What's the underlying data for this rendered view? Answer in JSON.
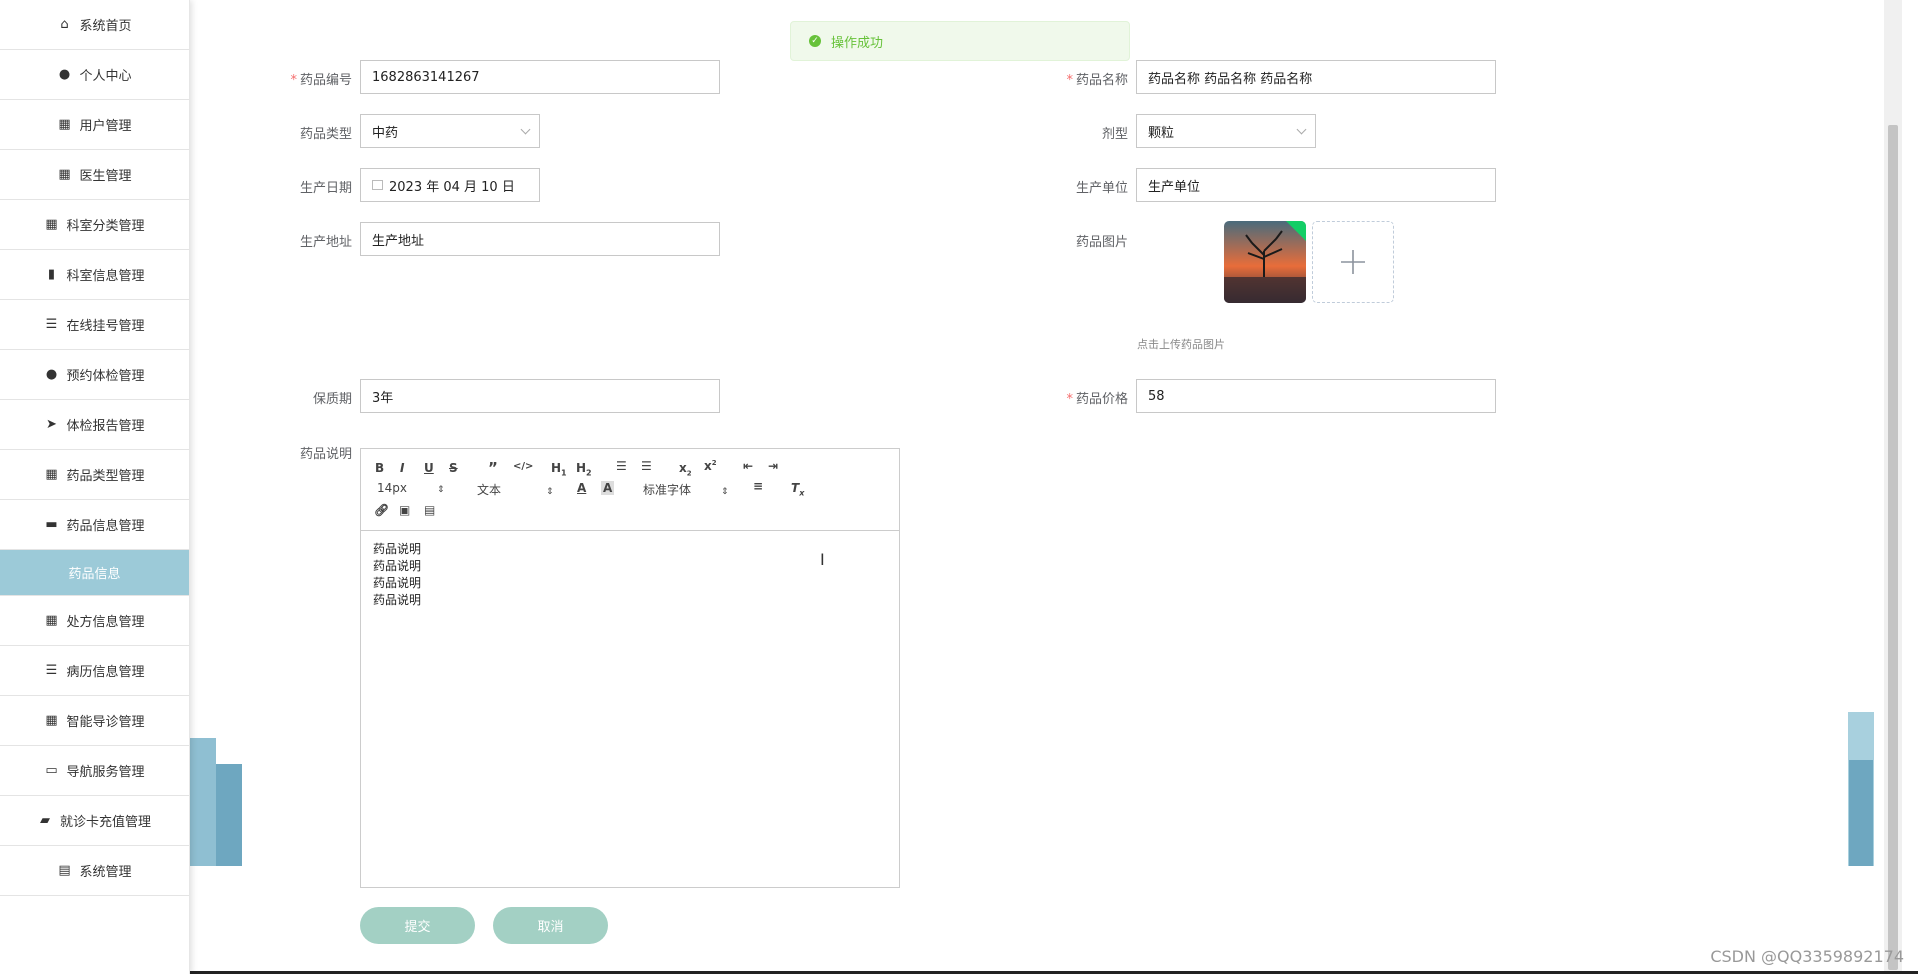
{
  "sidebar": {
    "items": [
      {
        "label": "系统首页",
        "icon": "home-icon"
      },
      {
        "label": "个人中心",
        "icon": "user-icon"
      },
      {
        "label": "用户管理",
        "icon": "grid-icon"
      },
      {
        "label": "医生管理",
        "icon": "grid-icon"
      },
      {
        "label": "科室分类管理",
        "icon": "grid-icon"
      },
      {
        "label": "科室信息管理",
        "icon": "clipboard-icon"
      },
      {
        "label": "在线挂号管理",
        "icon": "list-icon"
      },
      {
        "label": "预约体检管理",
        "icon": "user-icon"
      },
      {
        "label": "体检报告管理",
        "icon": "send-icon"
      },
      {
        "label": "药品类型管理",
        "icon": "grid-icon"
      },
      {
        "label": "药品信息管理",
        "icon": "monitor-icon"
      },
      {
        "label": "药品信息",
        "icon": ""
      },
      {
        "label": "处方信息管理",
        "icon": "grid-icon"
      },
      {
        "label": "病历信息管理",
        "icon": "list-icon"
      },
      {
        "label": "智能导诊管理",
        "icon": "grid-icon"
      },
      {
        "label": "导航服务管理",
        "icon": "ticket-icon"
      },
      {
        "label": "就诊卡充值管理",
        "icon": "briefcase-icon"
      },
      {
        "label": "系统管理",
        "icon": "printer-icon"
      }
    ],
    "active_bg": "#9ccad8"
  },
  "toast": {
    "text": "操作成功",
    "color": "#67c23a"
  },
  "form": {
    "code_label": "药品编号",
    "code_value": "1682863141267",
    "name_label": "药品名称",
    "name_value": "药品名称 药品名称 药品名称",
    "type_label": "药品类型",
    "type_value": "中药",
    "form_label": "剂型",
    "form_value": "颗粒",
    "date_label": "生产日期",
    "date_value": "2023 年 04 月 10 日",
    "maker_label": "生产单位",
    "maker_value": "生产单位",
    "addr_label": "生产地址",
    "addr_value": "生产地址",
    "image_label": "药品图片",
    "image_hint": "点击上传药品图片",
    "shelf_label": "保质期",
    "shelf_value": "3年",
    "price_label": "药品价格",
    "price_value": "58",
    "desc_label": "药品说明"
  },
  "editor": {
    "font_size": "14px",
    "block": "文本",
    "font": "标准字体",
    "lines": [
      "药品说明",
      "药品说明",
      "药品说明",
      "药品说明"
    ]
  },
  "buttons": {
    "submit": "提交",
    "cancel": "取消"
  },
  "watermark": "CSDN @QQ3359892174"
}
